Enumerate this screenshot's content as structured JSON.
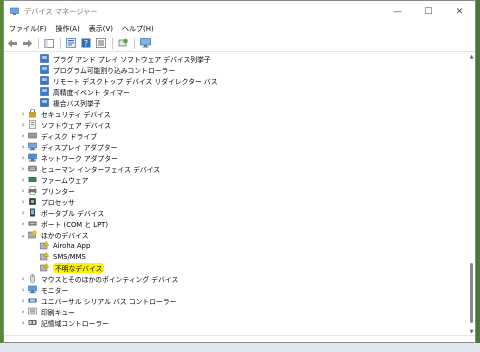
{
  "window": {
    "title": "デバイス マネージャー"
  },
  "win_controls": {
    "minimize": "—",
    "maximize": "☐",
    "close": "✕"
  },
  "menu": [
    "ファイル(F)",
    "操作(A)",
    "表示(V)",
    "ヘルプ(H)"
  ],
  "tree": [
    {
      "label": "プラグ アンド プレイ ソフトウェア デバイス列挙子",
      "level": 2,
      "icon": "system-device-icon",
      "expander": ""
    },
    {
      "label": "プログラム可能割り込みコントローラー",
      "level": 2,
      "icon": "system-device-icon",
      "expander": ""
    },
    {
      "label": "リモート デスクトップ デバイス リダイレクター バス",
      "level": 2,
      "icon": "system-device-icon",
      "expander": ""
    },
    {
      "label": "高精度イベント タイマー",
      "level": 2,
      "icon": "system-device-icon",
      "expander": ""
    },
    {
      "label": "複合バス列挙子",
      "level": 2,
      "icon": "system-device-icon",
      "expander": ""
    },
    {
      "label": "セキュリティ デバイス",
      "level": 1,
      "icon": "security-device-icon",
      "expander": "›"
    },
    {
      "label": "ソフトウェア デバイス",
      "level": 1,
      "icon": "software-device-icon",
      "expander": "›"
    },
    {
      "label": "ディスク ドライブ",
      "level": 1,
      "icon": "disk-drive-icon",
      "expander": "›"
    },
    {
      "label": "ディスプレイ アダプター",
      "level": 1,
      "icon": "display-adapter-icon",
      "expander": "›"
    },
    {
      "label": "ネットワーク アダプター",
      "level": 1,
      "icon": "network-adapter-icon",
      "expander": "›"
    },
    {
      "label": "ヒューマン インターフェイス デバイス",
      "level": 1,
      "icon": "hid-icon",
      "expander": "›"
    },
    {
      "label": "ファームウェア",
      "level": 1,
      "icon": "firmware-icon",
      "expander": "›"
    },
    {
      "label": "プリンター",
      "level": 1,
      "icon": "printer-icon",
      "expander": "›"
    },
    {
      "label": "プロセッサ",
      "level": 1,
      "icon": "processor-icon",
      "expander": "›"
    },
    {
      "label": "ポータブル デバイス",
      "level": 1,
      "icon": "portable-device-icon",
      "expander": "›"
    },
    {
      "label": "ポート (COM と LPT)",
      "level": 1,
      "icon": "port-icon",
      "expander": "›"
    },
    {
      "label": "ほかのデバイス",
      "level": 1,
      "icon": "other-devices-icon",
      "expander": "⌄"
    },
    {
      "label": "Airoha App",
      "level": 2,
      "icon": "unknown-device-icon",
      "expander": ""
    },
    {
      "label": "SMS/MMS",
      "level": 2,
      "icon": "unknown-device-icon",
      "expander": ""
    },
    {
      "label": "不明なデバイス",
      "level": 2,
      "icon": "unknown-device-icon",
      "expander": "",
      "highlight": true
    },
    {
      "label": "マウスとそのほかのポインティング デバイス",
      "level": 1,
      "icon": "mouse-icon",
      "expander": "›"
    },
    {
      "label": "モニター",
      "level": 1,
      "icon": "monitor-icon",
      "expander": "›"
    },
    {
      "label": "ユニバーサル シリアル バス コントローラー",
      "level": 1,
      "icon": "usb-controller-icon",
      "expander": "›"
    },
    {
      "label": "印刷キュー",
      "level": 1,
      "icon": "print-queue-icon",
      "expander": "›"
    },
    {
      "label": "記憶域コントローラー",
      "level": 1,
      "icon": "storage-controller-icon",
      "expander": "›"
    }
  ],
  "colors": {
    "highlight": "#fff200",
    "accent": "#1e5aa8"
  }
}
